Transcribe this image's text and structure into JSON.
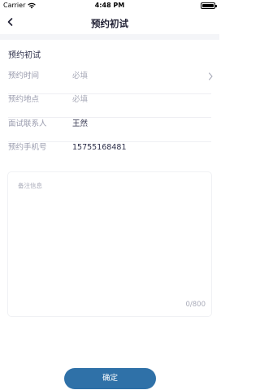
{
  "status_bar": {
    "carrier": "Carrier",
    "time": "4:48 PM"
  },
  "nav": {
    "title": "预约初试",
    "back_icon": "chevron-left-icon"
  },
  "form": {
    "section_title": "预约初试",
    "rows": [
      {
        "label": "预约时间",
        "value": "必填",
        "state": "placeholder",
        "has_chevron": true
      },
      {
        "label": "预约地点",
        "value": "必填",
        "state": "placeholder",
        "has_chevron": false
      },
      {
        "label": "面试联系人",
        "value": "王然",
        "state": "filled",
        "has_chevron": false
      },
      {
        "label": "预约手机号",
        "value": "15755168481",
        "state": "filled",
        "has_chevron": false
      }
    ]
  },
  "remarks": {
    "placeholder": "备注信息",
    "counter": "0/800"
  },
  "actions": {
    "confirm_label": "确定"
  },
  "colors": {
    "primary_button": "#2f71a8",
    "label_text": "#9a9cae",
    "value_text": "#2d2f4a",
    "divider_band": "#f4f5f8"
  }
}
